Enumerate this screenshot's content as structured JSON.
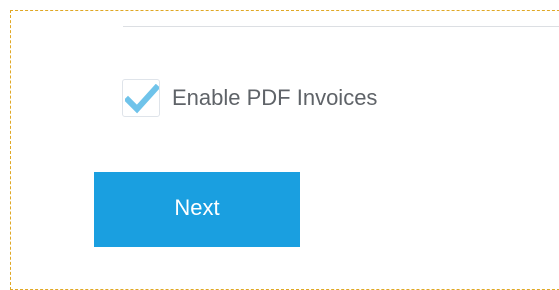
{
  "pdf_invoices": {
    "label": "Enable PDF Invoices",
    "checked": true,
    "check_icon": "checkmark-icon",
    "check_color": "#6fc3ea"
  },
  "actions": {
    "next_label": "Next",
    "next_color": "#1a9fe0"
  },
  "frame": {
    "border_color": "#e0a825"
  }
}
